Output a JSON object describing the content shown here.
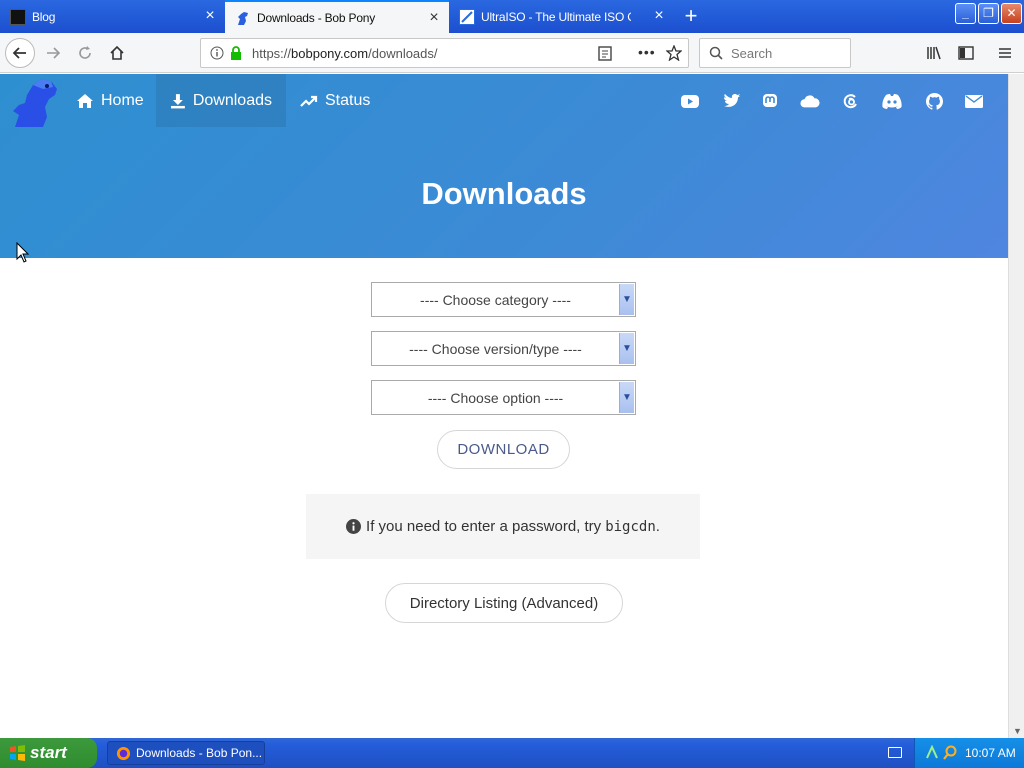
{
  "browser": {
    "tabs": [
      {
        "title": "Blog",
        "active": false
      },
      {
        "title": "Downloads - Bob Pony",
        "active": true
      },
      {
        "title": "UltraISO - The Ultimate ISO CD/D",
        "active": false
      }
    ],
    "url_prefix": "https://",
    "url_host": "bobpony.com",
    "url_path": "/downloads/",
    "search_placeholder": "Search"
  },
  "site": {
    "nav": [
      {
        "label": "Home",
        "icon": "home-icon"
      },
      {
        "label": "Downloads",
        "icon": "download-icon",
        "active": true
      },
      {
        "label": "Status",
        "icon": "trending-up-icon"
      }
    ],
    "social_icons": [
      "youtube-icon",
      "twitter-icon",
      "mastodon-icon",
      "cloud-icon",
      "threads-icon",
      "discord-icon",
      "github-icon",
      "mail-icon"
    ],
    "page_title": "Downloads",
    "selects": [
      "---- Choose category ----",
      "---- Choose version/type ----",
      "---- Choose option ----"
    ],
    "download_label": "DOWNLOAD",
    "info_text": "If you need to enter a password, try",
    "info_code": "bigcdn",
    "info_suffix": ".",
    "directory_label": "Directory Listing (Advanced)",
    "colors": {
      "hero_start": "#2e8fd0",
      "hero_end": "#4f86e0"
    }
  },
  "taskbar": {
    "start_label": "start",
    "app_label": "Downloads - Bob Pon...",
    "clock": "10:07 AM"
  }
}
